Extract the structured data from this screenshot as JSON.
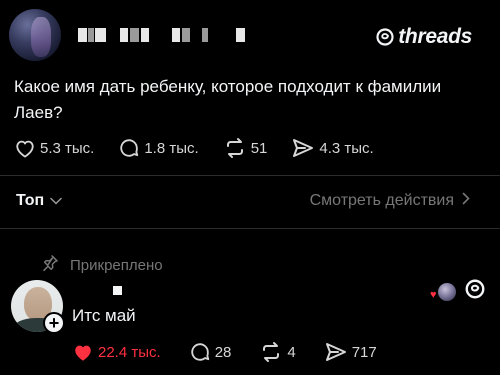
{
  "header": {
    "username_redacted": true,
    "brand_label": "threads",
    "brand_icon": "threads-logo-icon"
  },
  "post": {
    "text": "Какое имя дать ребенку, которое подходит к фамилии Лаев?",
    "actions": {
      "likes": "5.3 тыс.",
      "replies": "1.8 тыс.",
      "reposts": "51",
      "shares": "4.3 тыс."
    }
  },
  "sort": {
    "label": "Топ",
    "view_activity": "Смотреть действия"
  },
  "pinned_reply": {
    "pinned_label": "Прикреплено",
    "text": "Итс май",
    "actions": {
      "likes": "22.4 тыс.",
      "replies": "28",
      "reposts": "4",
      "shares": "717"
    },
    "like_color": "#ff3040"
  },
  "colors": {
    "background": "#000000",
    "text": "#f3f5f7",
    "muted": "#777777",
    "accent_like": "#ff3040"
  }
}
